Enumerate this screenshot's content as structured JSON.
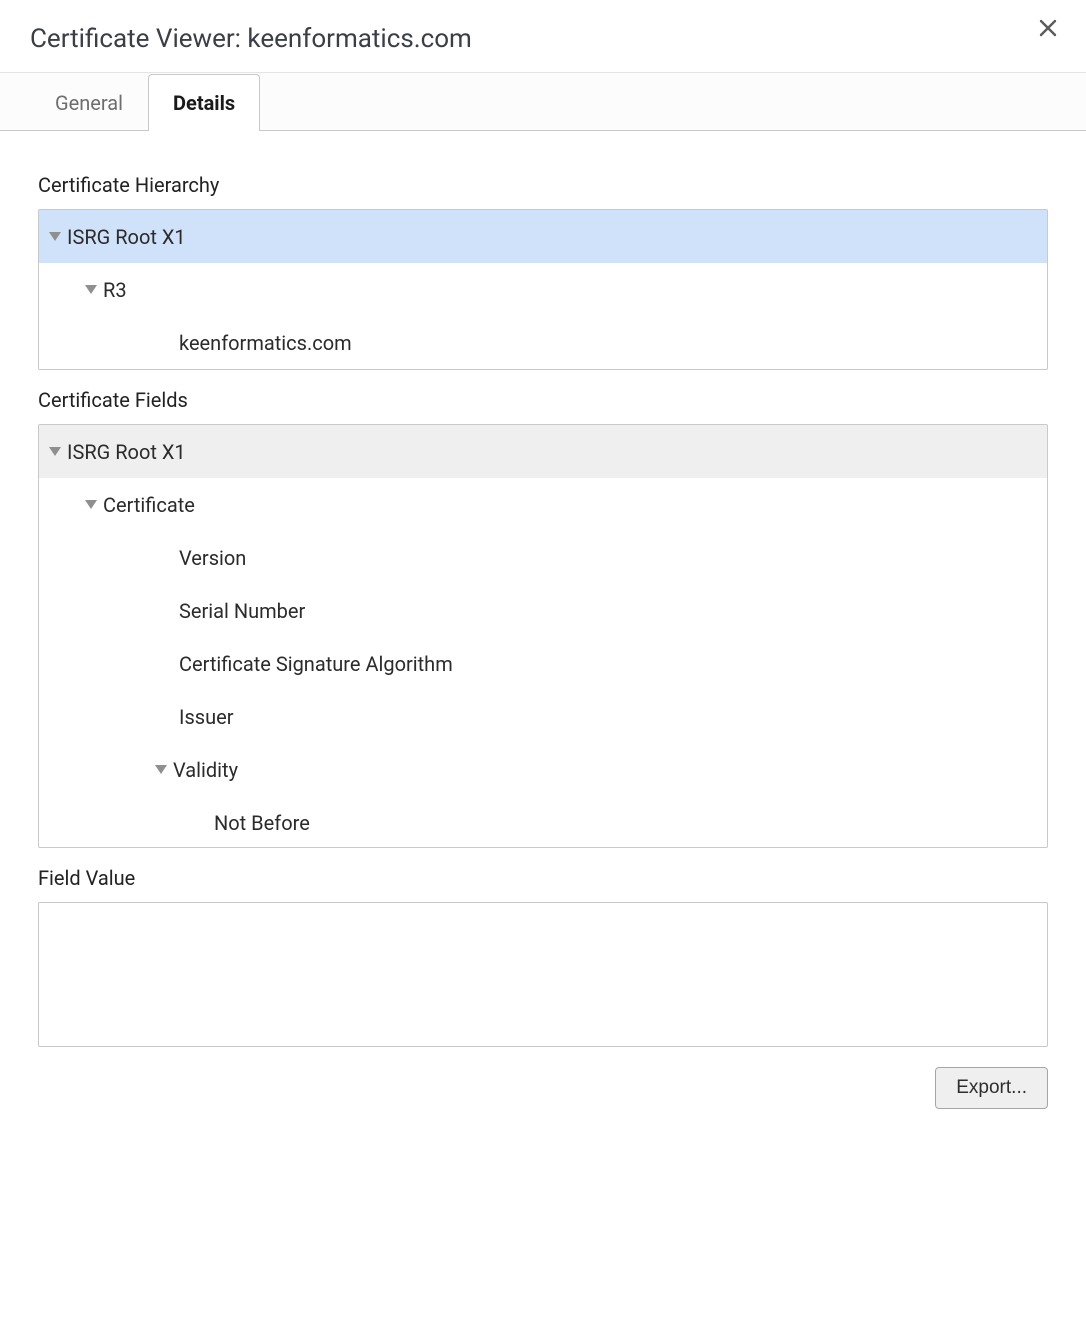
{
  "header": {
    "title": "Certificate Viewer: keenformatics.com"
  },
  "tabs": [
    {
      "label": "General",
      "active": false
    },
    {
      "label": "Details",
      "active": true
    }
  ],
  "sections": {
    "hierarchy": {
      "title": "Certificate Hierarchy"
    },
    "fields": {
      "title": "Certificate Fields"
    },
    "field_value": {
      "title": "Field Value"
    }
  },
  "hierarchy": [
    {
      "label": "ISRG Root X1",
      "selected": true,
      "children": [
        {
          "label": "R3",
          "children": [
            {
              "label": "keenformatics.com"
            }
          ]
        }
      ]
    }
  ],
  "fields": [
    {
      "label": "ISRG Root X1",
      "children": [
        {
          "label": "Certificate",
          "children": [
            {
              "label": "Version"
            },
            {
              "label": "Serial Number"
            },
            {
              "label": "Certificate Signature Algorithm"
            },
            {
              "label": "Issuer"
            },
            {
              "label": "Validity",
              "children": [
                {
                  "label": "Not Before"
                }
              ]
            }
          ]
        }
      ]
    }
  ],
  "field_value": "",
  "footer": {
    "export_label": "Export..."
  }
}
